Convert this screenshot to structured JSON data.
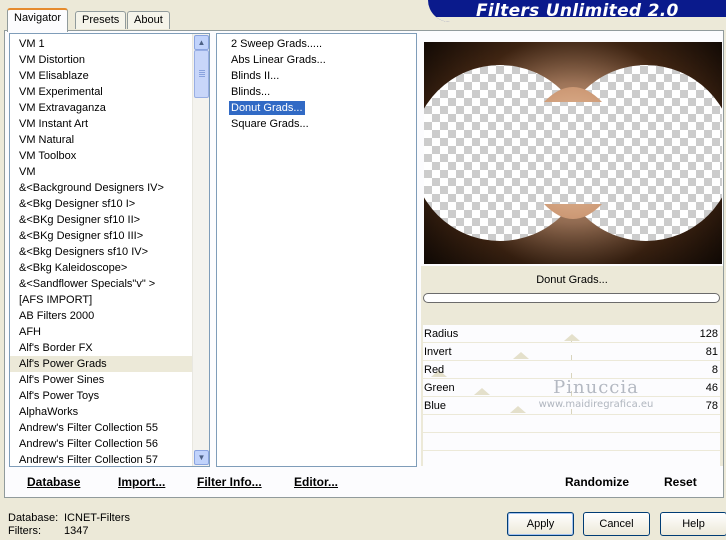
{
  "tabs": [
    {
      "label": "Navigator",
      "active": true
    },
    {
      "label": "Presets",
      "active": false
    },
    {
      "label": "About",
      "active": false
    }
  ],
  "banner": {
    "title": "Filters Unlimited 2.0"
  },
  "categories": [
    "VM 1",
    "VM Distortion",
    "VM Elisablaze",
    "VM Experimental",
    "VM Extravaganza",
    "VM Instant Art",
    "VM Natural",
    "VM Toolbox",
    "VM",
    "&<Background Designers IV>",
    "&<Bkg Designer sf10 I>",
    "&<BKg Designer sf10 II>",
    "&<BKg Designer sf10 III>",
    "&<Bkg Designers sf10 IV>",
    "&<Bkg Kaleidoscope>",
    "&<Sandflower Specials\"v\" >",
    "[AFS IMPORT]",
    "AB Filters 2000",
    "AFH",
    "Alf's Border FX",
    "Alf's Power Grads",
    "Alf's Power Sines",
    "Alf's Power Toys",
    "AlphaWorks",
    "Andrew's Filter Collection 55",
    "Andrew's Filter Collection 56",
    "Andrew's Filter Collection 57"
  ],
  "selected_category": "Alf's Power Grads",
  "filters": [
    "2 Sweep Grads.....",
    "Abs Linear Grads...",
    "Blinds II...",
    "Blinds...",
    "Donut Grads...",
    "Square Grads..."
  ],
  "selected_filter": "Donut Grads...",
  "filter_name": "Donut Grads...",
  "params": [
    {
      "label": "Radius",
      "value": "128",
      "level": 0.5
    },
    {
      "label": "Invert",
      "value": "81",
      "level": 0.32
    },
    {
      "label": "Red",
      "value": "8",
      "level": 0.03
    },
    {
      "label": "Green",
      "value": "46",
      "level": 0.18
    },
    {
      "label": "Blue",
      "value": "78",
      "level": 0.31
    }
  ],
  "watermark": {
    "title": "Pinuccia",
    "subtitle": "www.maidiregrafica.eu"
  },
  "actions": {
    "database": "Database",
    "import": "Import...",
    "filter_info": "Filter Info...",
    "editor": "Editor...",
    "randomize": "Randomize",
    "reset": "Reset"
  },
  "footer": {
    "database_label": "Database:",
    "database_value": "ICNET-Filters",
    "filters_label": "Filters:",
    "filters_value": "1347"
  },
  "buttons": {
    "apply": "Apply",
    "cancel": "Cancel",
    "help": "Help"
  },
  "colors": {
    "banner": "#0a1a8c",
    "selection": "#316ac5",
    "gradient_light": "#f2cfae",
    "gradient_dark": "#1a0d04"
  }
}
